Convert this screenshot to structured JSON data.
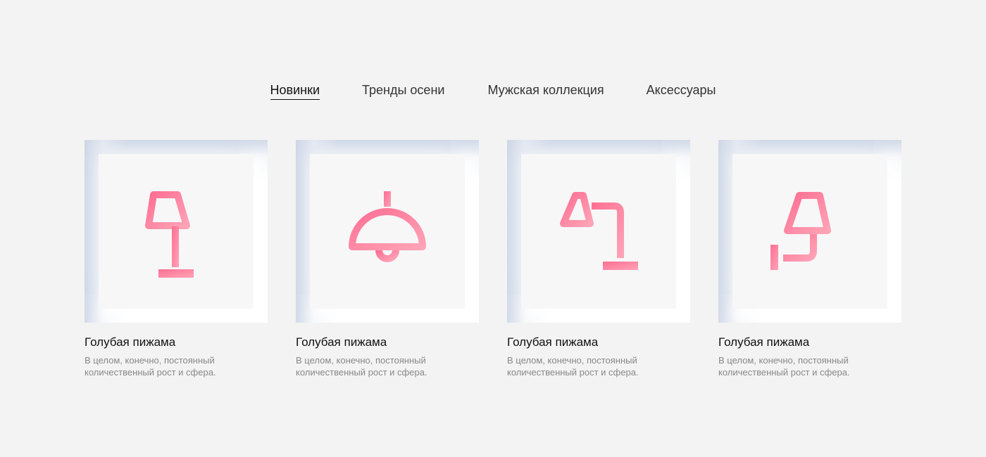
{
  "tabs": [
    {
      "label": "Новинки",
      "active": true
    },
    {
      "label": "Тренды осени",
      "active": false
    },
    {
      "label": "Мужская коллекция",
      "active": false
    },
    {
      "label": "Аксессуары",
      "active": false
    }
  ],
  "products": [
    {
      "icon": "table-lamp-icon",
      "title": "Голубая пижама",
      "description": "В целом, конечно, постоянный количественный рост и сфера."
    },
    {
      "icon": "pendant-lamp-icon",
      "title": "Голубая пижама",
      "description": "В целом, конечно, постоянный количественный рост и сфера."
    },
    {
      "icon": "desk-lamp-icon",
      "title": "Голубая пижама",
      "description": "В целом, конечно, постоянный количественный рост и сфера."
    },
    {
      "icon": "wall-lamp-icon",
      "title": "Голубая пижама",
      "description": "В целом, конечно, постоянный количественный рост и сфера."
    }
  ],
  "colors": {
    "background": "#f3f3f3",
    "icon_gradient_start": "#ff6f93",
    "icon_gradient_end": "#ffa3b6",
    "text_primary": "#111111",
    "text_secondary": "#888888"
  }
}
